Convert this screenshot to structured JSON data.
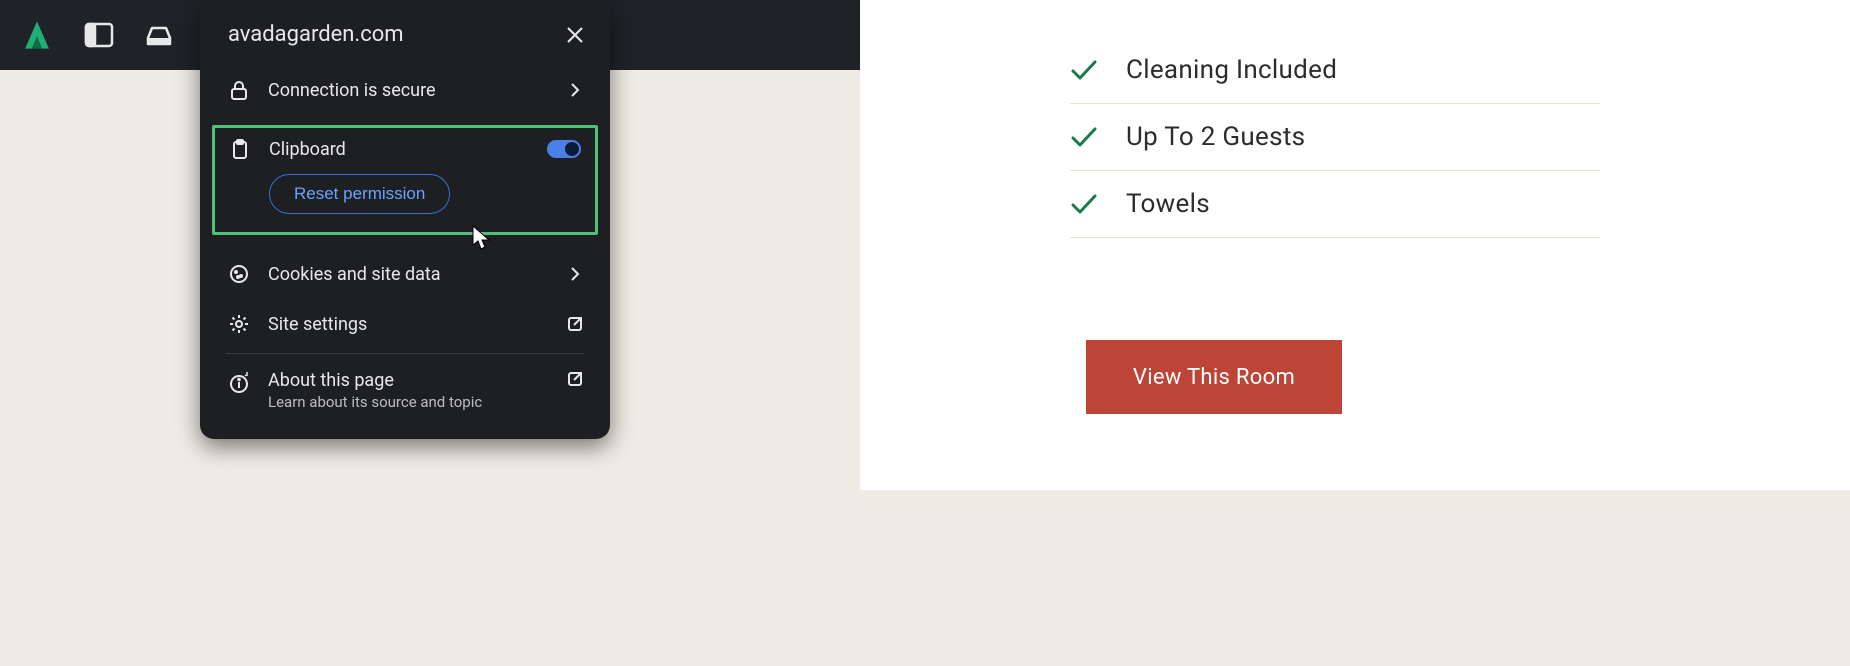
{
  "popup": {
    "domain": "avadagarden.com",
    "connection_label": "Connection is secure",
    "clipboard_label": "Clipboard",
    "clipboard_toggle": true,
    "reset_label": "Reset permission",
    "cookies_label": "Cookies and site data",
    "settings_label": "Site settings",
    "about_label": "About this page",
    "about_sub": "Learn about its source and topic"
  },
  "features": [
    "Cleaning Included",
    "Up To 2 Guests",
    "Towels"
  ],
  "cta_label": "View This Room"
}
